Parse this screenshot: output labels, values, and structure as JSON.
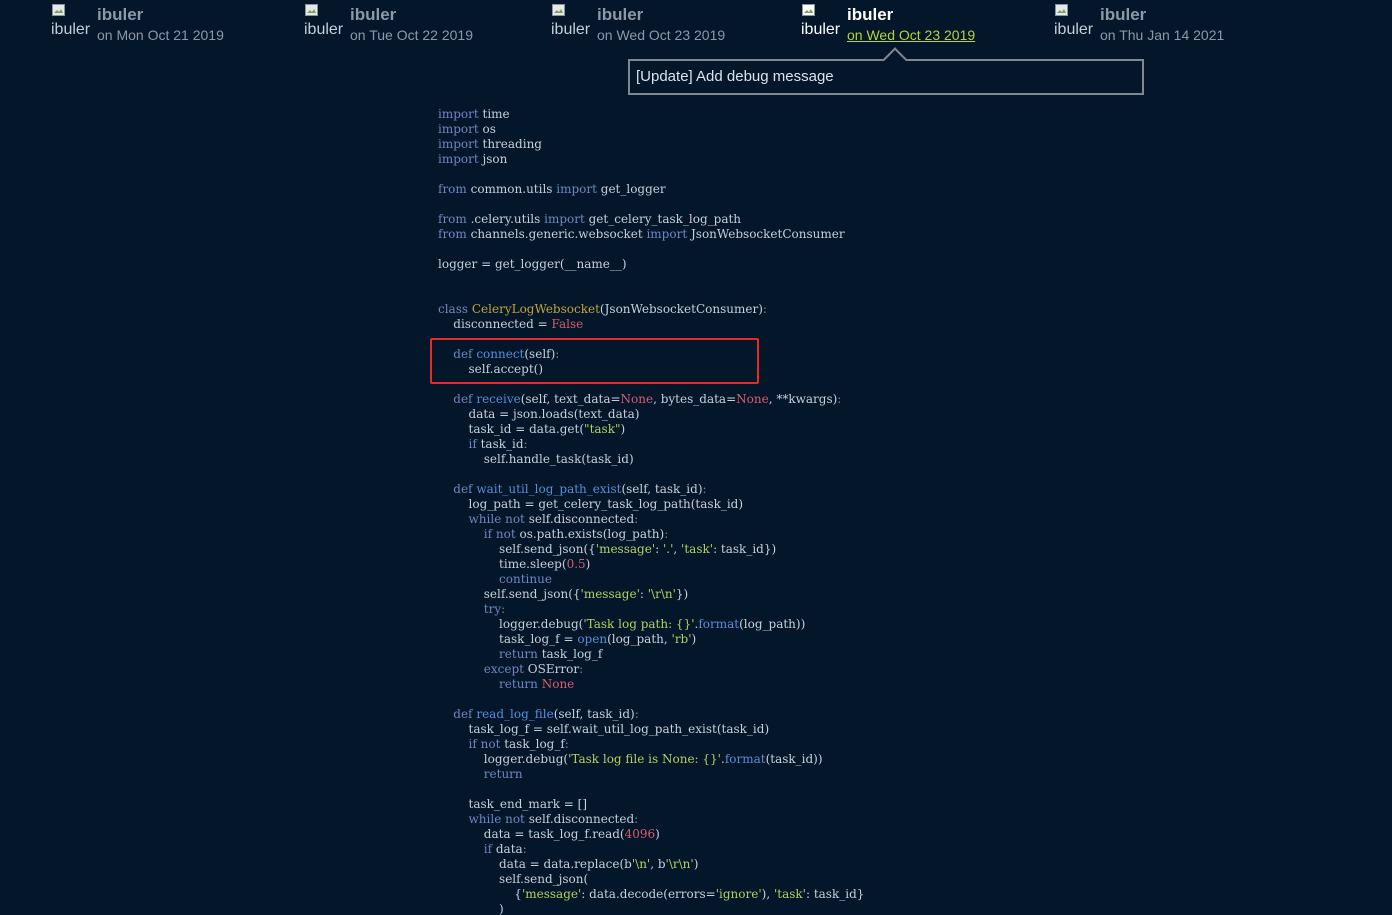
{
  "commits": [
    {
      "avatar_alt": "ibuler",
      "author": "ibuler",
      "date": "on Mon Oct 21 2019",
      "active": false
    },
    {
      "avatar_alt": "ibuler",
      "author": "ibuler",
      "date": "on Tue Oct 22 2019",
      "active": false
    },
    {
      "avatar_alt": "ibuler",
      "author": "ibuler",
      "date": "on Wed Oct 23 2019",
      "active": false
    },
    {
      "avatar_alt": "ibuler",
      "author": "ibuler",
      "date": "on Wed Oct 23 2019",
      "active": true
    },
    {
      "avatar_alt": "ibuler",
      "author": "ibuler",
      "date": "on Thu Jan 14 2021",
      "active": false
    }
  ],
  "tooltip": {
    "message": "[Update] Add debug message"
  },
  "code_lines": [
    [
      {
        "t": "import",
        "c": "kw"
      },
      {
        "t": " time"
      }
    ],
    [
      {
        "t": "import",
        "c": "kw"
      },
      {
        "t": " os"
      }
    ],
    [
      {
        "t": "import",
        "c": "kw"
      },
      {
        "t": " threading"
      }
    ],
    [
      {
        "t": "import",
        "c": "kw"
      },
      {
        "t": " json"
      }
    ],
    [],
    [
      {
        "t": "from",
        "c": "kw"
      },
      {
        "t": " common.utils "
      },
      {
        "t": "import",
        "c": "kw"
      },
      {
        "t": " get_logger"
      }
    ],
    [],
    [
      {
        "t": "from",
        "c": "kw"
      },
      {
        "t": " .celery.utils "
      },
      {
        "t": "import",
        "c": "kw"
      },
      {
        "t": " get_celery_task_log_path"
      }
    ],
    [
      {
        "t": "from",
        "c": "kw"
      },
      {
        "t": " channels.generic.websocket "
      },
      {
        "t": "import",
        "c": "kw"
      },
      {
        "t": " JsonWebsocketConsumer"
      }
    ],
    [],
    [
      {
        "t": "logger = get_logger(__name__)"
      }
    ],
    [],
    [],
    [
      {
        "t": "class",
        "c": "kw"
      },
      {
        "t": " "
      },
      {
        "t": "CeleryLogWebsocket",
        "c": "cls"
      },
      {
        "t": "(JsonWebsocketConsumer)"
      },
      {
        "t": ":",
        "c": "op"
      }
    ],
    [
      {
        "t": "    disconnected = "
      },
      {
        "t": "False",
        "c": "num"
      }
    ],
    [],
    [
      {
        "t": "    "
      },
      {
        "t": "def",
        "c": "kw"
      },
      {
        "t": " "
      },
      {
        "t": "connect",
        "c": "fn"
      },
      {
        "t": "(self)"
      },
      {
        "t": ":",
        "c": "op"
      }
    ],
    [
      {
        "t": "        self.accept()"
      }
    ],
    [],
    [
      {
        "t": "    "
      },
      {
        "t": "def",
        "c": "kw"
      },
      {
        "t": " "
      },
      {
        "t": "receive",
        "c": "fn"
      },
      {
        "t": "(self, text_data="
      },
      {
        "t": "None",
        "c": "num"
      },
      {
        "t": ", bytes_data="
      },
      {
        "t": "None",
        "c": "num"
      },
      {
        "t": ", **kwargs)"
      },
      {
        "t": ":",
        "c": "op"
      }
    ],
    [
      {
        "t": "        data = json.loads(text_data)"
      }
    ],
    [
      {
        "t": "        task_id = data.get("
      },
      {
        "t": "\"task\"",
        "c": "str"
      },
      {
        "t": ")"
      }
    ],
    [
      {
        "t": "        "
      },
      {
        "t": "if",
        "c": "kw"
      },
      {
        "t": " task_id"
      },
      {
        "t": ":",
        "c": "op"
      }
    ],
    [
      {
        "t": "            self.handle_task(task_id)"
      }
    ],
    [],
    [
      {
        "t": "    "
      },
      {
        "t": "def",
        "c": "kw"
      },
      {
        "t": " "
      },
      {
        "t": "wait_util_log_path_exist",
        "c": "fn"
      },
      {
        "t": "(self, task_id)"
      },
      {
        "t": ":",
        "c": "op"
      }
    ],
    [
      {
        "t": "        log_path = get_celery_task_log_path(task_id)"
      }
    ],
    [
      {
        "t": "        "
      },
      {
        "t": "while not",
        "c": "kw"
      },
      {
        "t": " self.disconnected"
      },
      {
        "t": ":",
        "c": "op"
      }
    ],
    [
      {
        "t": "            "
      },
      {
        "t": "if not",
        "c": "kw"
      },
      {
        "t": " os.path.exists(log_path)"
      },
      {
        "t": ":",
        "c": "op"
      }
    ],
    [
      {
        "t": "                self.send_json({"
      },
      {
        "t": "'message'",
        "c": "str"
      },
      {
        "t": ": "
      },
      {
        "t": "'.'",
        "c": "str"
      },
      {
        "t": ", "
      },
      {
        "t": "'task'",
        "c": "str"
      },
      {
        "t": ": task_id})"
      }
    ],
    [
      {
        "t": "                time.sleep("
      },
      {
        "t": "0.5",
        "c": "num"
      },
      {
        "t": ")"
      }
    ],
    [
      {
        "t": "                "
      },
      {
        "t": "continue",
        "c": "kw"
      }
    ],
    [
      {
        "t": "            self.send_json({"
      },
      {
        "t": "'message'",
        "c": "str"
      },
      {
        "t": ": "
      },
      {
        "t": "'\\r\\n'",
        "c": "str"
      },
      {
        "t": "})"
      }
    ],
    [
      {
        "t": "            "
      },
      {
        "t": "try",
        "c": "kw"
      },
      {
        "t": ":",
        "c": "op"
      }
    ],
    [
      {
        "t": "                logger.debug("
      },
      {
        "t": "'Task log path: {}'",
        "c": "str"
      },
      {
        "t": "."
      },
      {
        "t": "format",
        "c": "fn"
      },
      {
        "t": "(log_path))"
      }
    ],
    [
      {
        "t": "                task_log_f = "
      },
      {
        "t": "open",
        "c": "fn"
      },
      {
        "t": "(log_path, "
      },
      {
        "t": "'rb'",
        "c": "str"
      },
      {
        "t": ")"
      }
    ],
    [
      {
        "t": "                "
      },
      {
        "t": "return",
        "c": "kw"
      },
      {
        "t": " task_log_f"
      }
    ],
    [
      {
        "t": "            "
      },
      {
        "t": "except",
        "c": "kw"
      },
      {
        "t": " OSError"
      },
      {
        "t": ":",
        "c": "op"
      }
    ],
    [
      {
        "t": "                "
      },
      {
        "t": "return",
        "c": "kw"
      },
      {
        "t": " "
      },
      {
        "t": "None",
        "c": "num"
      }
    ],
    [],
    [
      {
        "t": "    "
      },
      {
        "t": "def",
        "c": "kw"
      },
      {
        "t": " "
      },
      {
        "t": "read_log_file",
        "c": "fn"
      },
      {
        "t": "(self, task_id)"
      },
      {
        "t": ":",
        "c": "op"
      }
    ],
    [
      {
        "t": "        task_log_f = self.wait_util_log_path_exist(task_id)"
      }
    ],
    [
      {
        "t": "        "
      },
      {
        "t": "if not",
        "c": "kw"
      },
      {
        "t": " task_log_f"
      },
      {
        "t": ":",
        "c": "op"
      }
    ],
    [
      {
        "t": "            logger.debug("
      },
      {
        "t": "'Task log file is None: {}'",
        "c": "str"
      },
      {
        "t": "."
      },
      {
        "t": "format",
        "c": "fn"
      },
      {
        "t": "(task_id))"
      }
    ],
    [
      {
        "t": "            "
      },
      {
        "t": "return",
        "c": "kw"
      }
    ],
    [],
    [
      {
        "t": "        task_end_mark = []"
      }
    ],
    [
      {
        "t": "        "
      },
      {
        "t": "while not",
        "c": "kw"
      },
      {
        "t": " self.disconnected"
      },
      {
        "t": ":",
        "c": "op"
      }
    ],
    [
      {
        "t": "            data = task_log_f.read("
      },
      {
        "t": "4096",
        "c": "num"
      },
      {
        "t": ")"
      }
    ],
    [
      {
        "t": "            "
      },
      {
        "t": "if",
        "c": "kw"
      },
      {
        "t": " data"
      },
      {
        "t": ":",
        "c": "op"
      }
    ],
    [
      {
        "t": "                data = data.replace(b"
      },
      {
        "t": "'\\n'",
        "c": "str"
      },
      {
        "t": ", b"
      },
      {
        "t": "'\\r\\n'",
        "c": "str"
      },
      {
        "t": ")"
      }
    ],
    [
      {
        "t": "                self.send_json("
      }
    ],
    [
      {
        "t": "                    {"
      },
      {
        "t": "'message'",
        "c": "str"
      },
      {
        "t": ": data.decode(errors="
      },
      {
        "t": "'ignore'",
        "c": "str"
      },
      {
        "t": "), "
      },
      {
        "t": "'task'",
        "c": "str"
      },
      {
        "t": ": task_id}"
      }
    ],
    [
      {
        "t": "                )"
      }
    ]
  ],
  "colors": {
    "background": "#03162a",
    "keyword": "#6f86bf",
    "function": "#5b8cd6",
    "class_name": "#c4a23b",
    "string": "#b5cf62",
    "number": "#d85c6c",
    "active_date": "#b5d33a",
    "highlight_box": "#e82a24"
  }
}
